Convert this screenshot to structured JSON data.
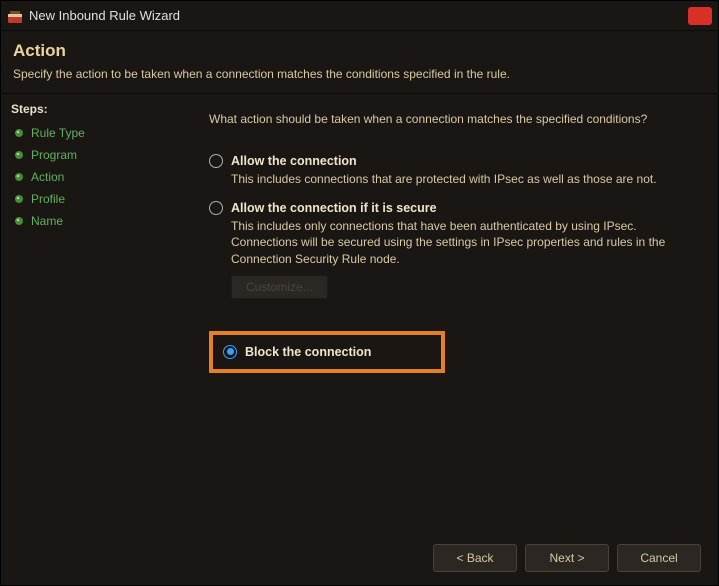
{
  "window": {
    "title": "New Inbound Rule Wizard"
  },
  "header": {
    "title": "Action",
    "description": "Specify the action to be taken when a connection matches the conditions specified in the rule."
  },
  "steps": {
    "label": "Steps:",
    "items": [
      {
        "label": "Rule Type"
      },
      {
        "label": "Program"
      },
      {
        "label": "Action"
      },
      {
        "label": "Profile"
      },
      {
        "label": "Name"
      }
    ]
  },
  "main": {
    "prompt": "What action should be taken when a connection matches the specified conditions?",
    "options": [
      {
        "label": "Allow the connection",
        "description": "This includes connections that are protected with IPsec as well as those are not.",
        "selected": false
      },
      {
        "label": "Allow the connection if it is secure",
        "description": "This includes only connections that have been authenticated by using IPsec.  Connections will be secured using the settings in IPsec properties and rules in the Connection Security Rule node.",
        "selected": false,
        "customize": "Customize..."
      },
      {
        "label": "Block the connection",
        "description": "",
        "selected": true,
        "highlighted": true
      }
    ]
  },
  "footer": {
    "back": "< Back",
    "next": "Next >",
    "cancel": "Cancel"
  }
}
